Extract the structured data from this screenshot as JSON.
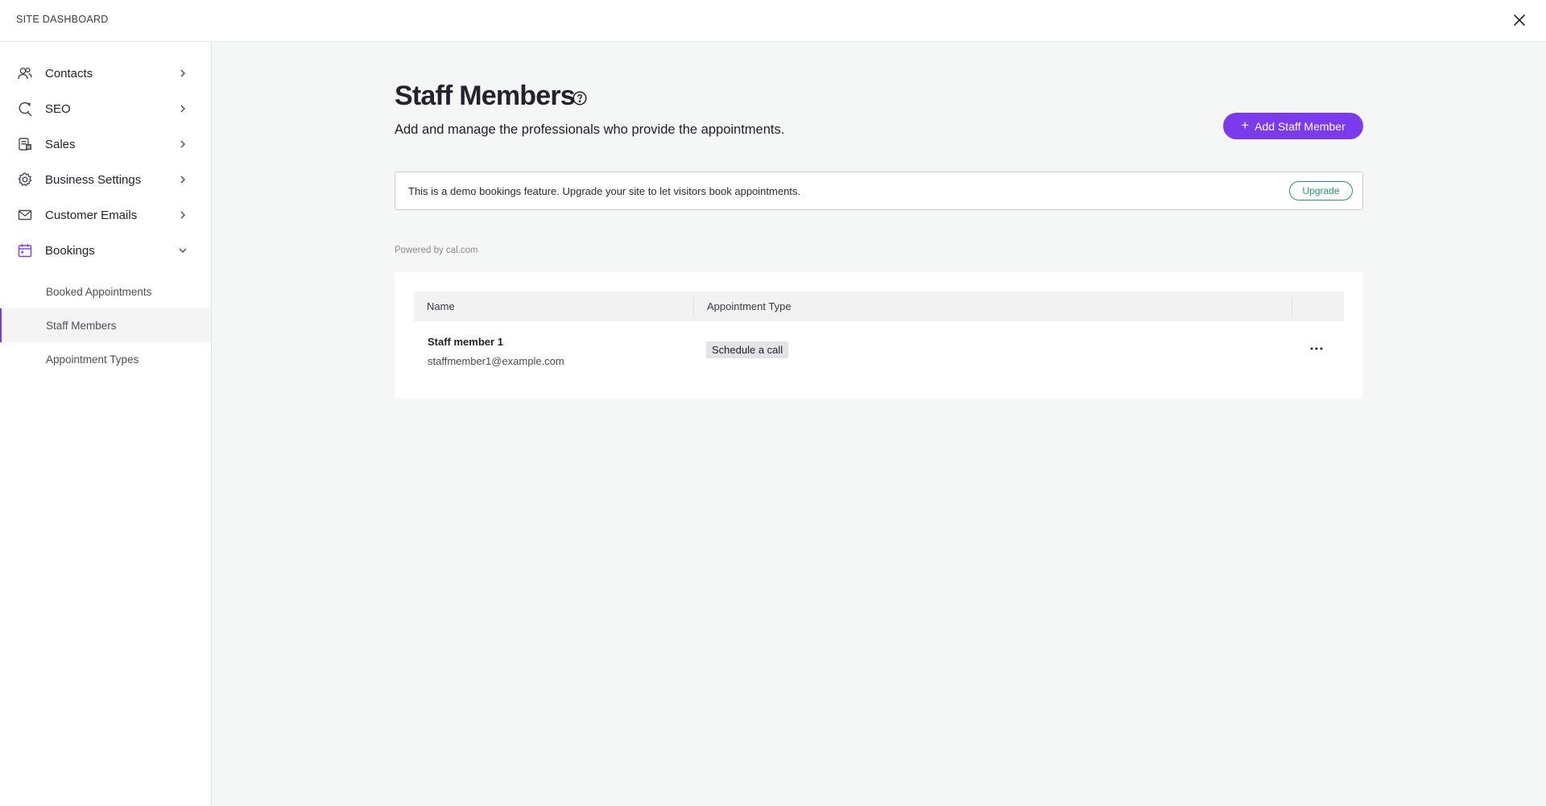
{
  "topbar": {
    "title": "SITE DASHBOARD"
  },
  "sidebar": {
    "items": [
      {
        "label": "Contacts",
        "icon": "contacts-icon"
      },
      {
        "label": "SEO",
        "icon": "seo-icon"
      },
      {
        "label": "Sales",
        "icon": "sales-icon"
      },
      {
        "label": "Business Settings",
        "icon": "gear-icon"
      },
      {
        "label": "Customer Emails",
        "icon": "mail-icon"
      },
      {
        "label": "Bookings",
        "icon": "calendar-icon",
        "expanded": true
      }
    ],
    "sub_items": [
      {
        "label": "Booked Appointments"
      },
      {
        "label": "Staff Members",
        "active": true
      },
      {
        "label": "Appointment Types"
      }
    ]
  },
  "main": {
    "title": "Staff Members",
    "subtitle": "Add and manage the professionals who provide the appointments.",
    "add_button": "Add Staff Member",
    "notice": {
      "text": "This is a demo bookings feature. Upgrade your site to let visitors book appointments.",
      "button": "Upgrade"
    },
    "powered_by": "Powered by cal.com",
    "table": {
      "columns": [
        "Name",
        "Appointment Type"
      ],
      "rows": [
        {
          "name": "Staff member 1",
          "email": "staffmember1@example.com",
          "appointment_type": "Schedule a call"
        }
      ]
    }
  },
  "colors": {
    "accent": "#7c3aed",
    "upgrade": "#1f9a6a",
    "bookings_icon": "#7c3aed"
  }
}
